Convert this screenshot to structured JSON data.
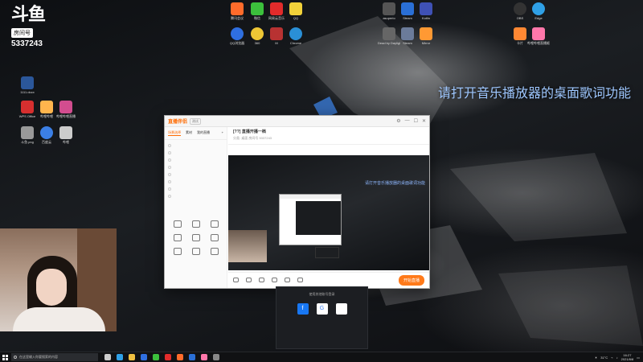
{
  "room": {
    "logo": "斗鱼",
    "tag": "房间号",
    "number": "5337243"
  },
  "lyric_overlay": "请打开音乐播放器的桌面歌词功能",
  "desktop_icons": [
    {
      "label": "腾讯会议",
      "color": "#ff6b2b"
    },
    {
      "label": "微信",
      "color": "#3cc03c"
    },
    {
      "label": "网易云音乐",
      "color": "#e22b2b"
    },
    {
      "label": "QQ",
      "color": "#f2d23a"
    },
    {
      "label": "asuperio",
      "color": "#555555"
    },
    {
      "label": "Steam",
      "color": "#2a6fd6"
    },
    {
      "label": "Kotlin",
      "color": "#3f51b5"
    },
    {
      "label": "OBS",
      "color": "#333333"
    },
    {
      "label": "Edge",
      "color": "#2fa0e6"
    },
    {
      "label": "QQ浏览器",
      "color": "#2f6fe0"
    },
    {
      "label": "360",
      "color": "#eec735"
    },
    {
      "label": "M",
      "color": "#b83232"
    },
    {
      "label": "Chrome",
      "color": "#2a8fd6"
    },
    {
      "label": "Dead by Daylight",
      "color": "#666666"
    },
    {
      "label": "Steam",
      "color": "#6b7b9a"
    },
    {
      "label": "Mirror",
      "color": "#ff9933"
    },
    {
      "label": "卡片",
      "color": "#ff8833"
    },
    {
      "label": "哔哩哔哩直播姬",
      "color": "#ff77aa"
    },
    {
      "label": "1111.docx",
      "color": "#2b579a"
    },
    {
      "label": "WPS Office",
      "color": "#d62f2f"
    },
    {
      "label": "哔哩哔哩",
      "color": "#ffb54d"
    },
    {
      "label": "哔哩哔哩直播",
      "color": "#d24d8f"
    },
    {
      "label": "斗鱼.png",
      "color": "#999999"
    },
    {
      "label": "百度云",
      "color": "#3b7fe5"
    },
    {
      "label": "哔哩",
      "color": "#cccccc"
    }
  ],
  "app": {
    "logo": "直播伴侣",
    "version": "测试",
    "left_tabs": [
      "场景选择",
      "素材",
      "我的直播"
    ],
    "scenes": [
      "",
      "",
      "",
      "",
      "",
      "",
      "",
      ""
    ],
    "tools": [
      "",
      "",
      "",
      "",
      "",
      "",
      "",
      "",
      ""
    ],
    "live_title": "[??] 直播开播一档",
    "live_sub": "分类: 桌面   房间号 5337243",
    "bottom_items": [
      "",
      "",
      "",
      "",
      "",
      ""
    ],
    "start_button": "开始直播"
  },
  "login_panel": {
    "title": "使用其他账号登录",
    "buttons": [
      "f",
      "G",
      ""
    ],
    "link": "",
    "sub": ""
  },
  "taskbar": {
    "search_placeholder": "在这里输入你要搜索的内容",
    "weather": "31°C",
    "time": "16:27",
    "date": "2021/8/8",
    "app_colors": [
      "#cccccc",
      "#2fa0e6",
      "#f0c040",
      "#2f6fe0",
      "#3cc03c",
      "#e22b2b",
      "#ff6b2b",
      "#2a6fd6",
      "#ff77aa",
      "#888888"
    ]
  }
}
